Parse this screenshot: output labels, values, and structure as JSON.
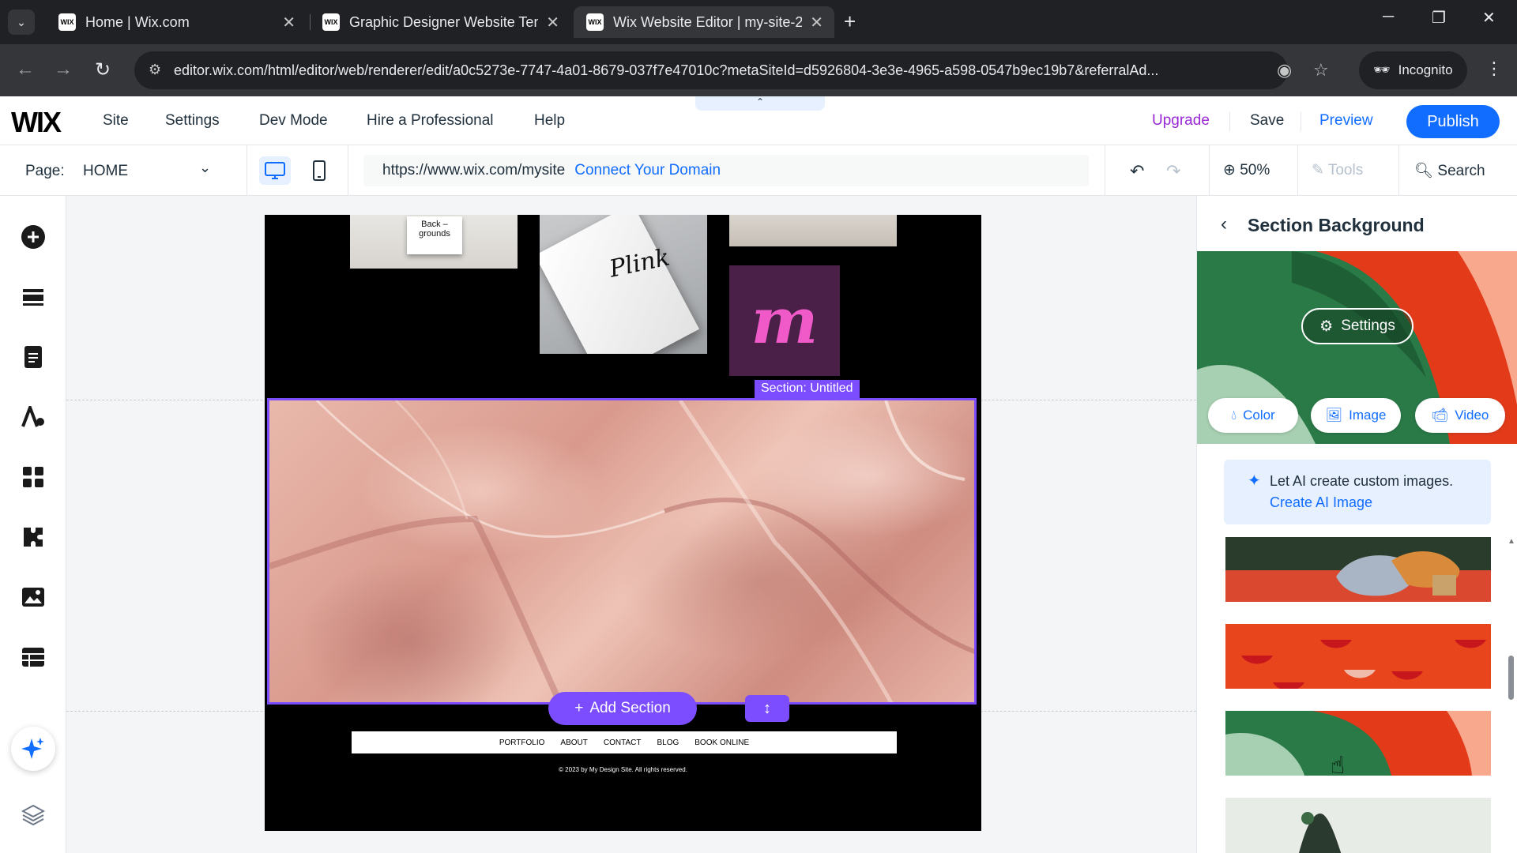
{
  "browser": {
    "tabs": [
      {
        "title": "Home | Wix.com",
        "favicon": "WIX"
      },
      {
        "title": "Graphic Designer Website Temp",
        "favicon": "WIX"
      },
      {
        "title": "Wix Website Editor | my-site-2",
        "favicon": "WIX"
      }
    ],
    "active_tab": 2,
    "url": "editor.wix.com/html/editor/web/renderer/edit/a0c5273e-7747-4a01-8679-037f7e47010c?metaSiteId=d5926804-3e3e-4965-a598-0547b9ec19b7&referralAd...",
    "incognito_label": "Incognito"
  },
  "topbar": {
    "logo": "WIX",
    "menu": [
      "Site",
      "Settings",
      "Dev Mode",
      "Hire a Professional",
      "Help"
    ],
    "upgrade": "Upgrade",
    "save": "Save",
    "preview": "Preview",
    "publish": "Publish"
  },
  "pagebar": {
    "page_label": "Page:",
    "page_name": "HOME",
    "site_url": "https://www.wix.com/mysite",
    "connect_domain": "Connect Your Domain",
    "zoom": "50%",
    "tools": "Tools",
    "search": "Search"
  },
  "canvas": {
    "mock1_text": "Back –\ngrounds",
    "mock2_text": "Plink",
    "mock4_text": "m",
    "section_tag": "Section: Untitled",
    "add_section": "Add Section",
    "footer_nav": [
      "PORTFOLIO",
      "ABOUT",
      "CONTACT",
      "BLOG",
      "BOOK ONLINE"
    ],
    "footer_copy": "© 2023 by My Design Site. All rights reserved."
  },
  "panel": {
    "title": "Section Background",
    "settings": "Settings",
    "options": [
      "Color",
      "Image",
      "Video"
    ],
    "ai_text": "Let AI create custom images.",
    "ai_link": "Create AI Image"
  },
  "colors": {
    "wix_blue": "#116dff",
    "selection_purple": "#7c4dff",
    "preview_green": "#2a7a48",
    "preview_red": "#e33b1a"
  }
}
